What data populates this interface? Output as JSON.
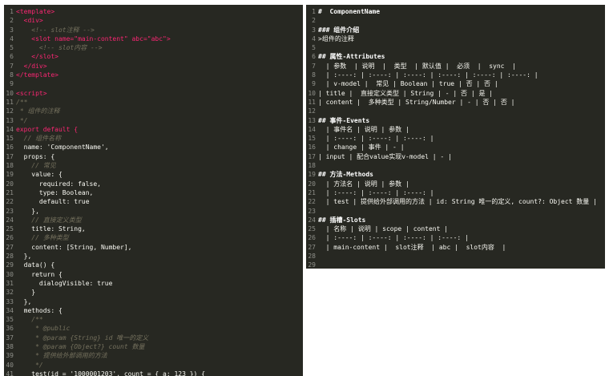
{
  "left_editor": {
    "lines": [
      "<template>",
      "  <div>",
      "    <!-- slot注释 -->",
      "    <slot name=\"main-content\" abc=\"abc\">",
      "      <!-- slot内容 -->",
      "    </slot>",
      "  </div>",
      "</template>",
      "",
      "<script>",
      "/**",
      " * 组件的注释",
      " */",
      "export default {",
      "  // 组件名称",
      "  name: 'ComponentName',",
      "  props: {",
      "    // 常见",
      "    value: {",
      "      required: false,",
      "      type: Boolean,",
      "      default: true",
      "    },",
      "    // 直接定义类型",
      "    title: String,",
      "    // 多种类型",
      "    content: [String, Number],",
      "  },",
      "  data() {",
      "    return {",
      "      dialogVisible: true",
      "    }",
      "  },",
      "  methods: {",
      "    /**",
      "     * @public",
      "     * @param {String} id 唯一的定义",
      "     * @param {Object?} count 数量",
      "     * 提供给外部调用的方法",
      "     */",
      "    test(id = '1000001203', count = { a: 123 }) {"
    ]
  },
  "right_editor": {
    "lines": [
      "#  ComponentName",
      "",
      "### 组件介绍",
      ">组件的注释",
      "",
      "## 属性-Attributes",
      "  | 参数  | 说明  |  类型  | 默认值 |  必须  |  sync  |",
      "  | :----: | :----: | :----: | :----: | :----: | :----: |",
      "  | v-model |  常见 | Boolean | true | 否 | 否 |",
      "| title |  直接定义类型 | String | - | 否 | 是 |",
      "| content |  多种类型 | String/Number | - | 否 | 否 |",
      "",
      "## 事件-Events",
      "  | 事件名 | 说明 | 参数 |",
      "  | :----: | :----: | :----: |",
      "  | change | 事件 | - |",
      "| input | 配合value实现v-model | - |",
      "",
      "## 方法-Methods",
      "  | 方法名 | 说明 | 参数 |",
      "  | :----: | :----: | :----: |",
      "  | test | 提供给外部调用的方法 | id: String 唯一的定义, count?: Object 数量 |",
      "",
      "## 插槽-Slots",
      "  | 名称 | 说明 | scope | content |",
      "  | :----: | :----: | :----: | :----: |",
      "  | main-content |  slot注释  | abc |  slot内容  |",
      "",
      ""
    ]
  },
  "colors": {
    "editor_bg": "#272822",
    "line_number": "#8f908a",
    "text": "#f8f8f2",
    "tag": "#f92672",
    "string": "#e6db74",
    "comment": "#75715e",
    "keyword": "#f92672",
    "boolean": "#ae81ff",
    "type": "#66d9ef"
  }
}
